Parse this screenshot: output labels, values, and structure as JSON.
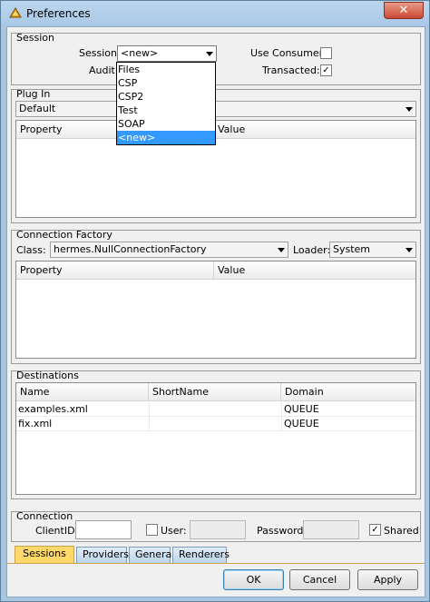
{
  "window": {
    "title": "Preferences",
    "close_glyph": "✕"
  },
  "session": {
    "group_label": "Session",
    "session_label": "Session:",
    "session_value": "<new>",
    "audit_label": "Audit:",
    "use_consumer_label": "Use Consumer:",
    "use_consumer_checked": false,
    "transacted_label": "Transacted:",
    "transacted_checked": true,
    "dropdown_options": [
      "Files",
      "CSP",
      "CSP2",
      "Test",
      "SOAP",
      "<new>"
    ],
    "dropdown_selected": "<new>"
  },
  "plugin": {
    "group_label": "Plug In",
    "combo_value": "Default",
    "columns": [
      "Property",
      "Value"
    ]
  },
  "connection_factory": {
    "group_label": "Connection Factory",
    "class_label": "Class:",
    "class_value": "hermes.NullConnectionFactory",
    "loader_label": "Loader:",
    "loader_value": "System",
    "columns": [
      "Property",
      "Value"
    ]
  },
  "destinations": {
    "group_label": "Destinations",
    "columns": [
      "Name",
      "ShortName",
      "Domain"
    ],
    "rows": [
      {
        "name": "examples.xml",
        "short": "",
        "domain": "QUEUE"
      },
      {
        "name": "fix.xml",
        "short": "",
        "domain": "QUEUE"
      }
    ]
  },
  "connection": {
    "group_label": "Connection",
    "clientid_label": "ClientID:",
    "clientid_value": "",
    "user_label": "User:",
    "user_checked": false,
    "password_label": "Password:",
    "shared_label": "Shared",
    "shared_checked": true
  },
  "tabs": [
    "Sessions",
    "Providers",
    "General",
    "Renderers"
  ],
  "active_tab": "Sessions",
  "buttons": {
    "ok": "OK",
    "cancel": "Cancel",
    "apply": "Apply"
  },
  "check_glyph": "✓",
  "colors": {
    "selection": "#3399ff",
    "active_tab": "#ffd86a"
  }
}
